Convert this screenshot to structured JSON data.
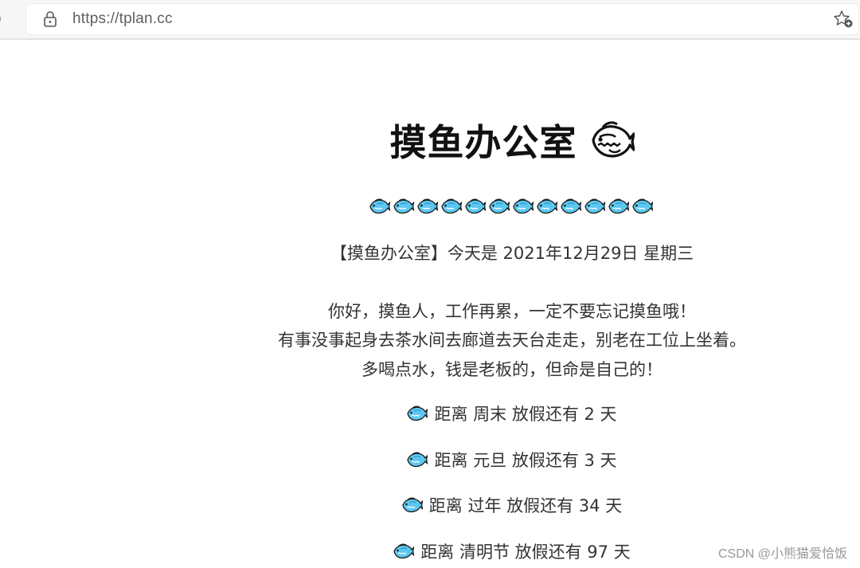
{
  "browser": {
    "url": "https://tplan.cc",
    "edge_glyph": ")"
  },
  "page": {
    "title": "摸鱼办公室",
    "title_icon": "fish-icon",
    "fish_row_icon": "fish-icon",
    "fish_row_count": 12,
    "date_line": "【摸鱼办公室】今天是 2021年12月29日 星期三",
    "greeting": [
      "你好，摸鱼人，工作再累，一定不要忘记摸鱼哦！",
      "有事没事起身去茶水间去廊道去天台走走，别老在工位上坐着。",
      "多喝点水，钱是老板的，但命是自己的！"
    ],
    "countdowns": [
      {
        "text": "距离 周末 放假还有 2 天"
      },
      {
        "text": "距离 元旦 放假还有 3 天"
      },
      {
        "text": "距离 过年 放假还有 34 天"
      },
      {
        "text": "距离 清明节 放假还有 97 天"
      }
    ]
  },
  "watermark": "CSDN @小熊猫爱恰饭",
  "colors": {
    "fish_body": "#5cc8f0",
    "fish_dark": "#2a8fc4",
    "fish_outline": "#1a1a1a",
    "text": "#333333",
    "title": "#111111"
  }
}
